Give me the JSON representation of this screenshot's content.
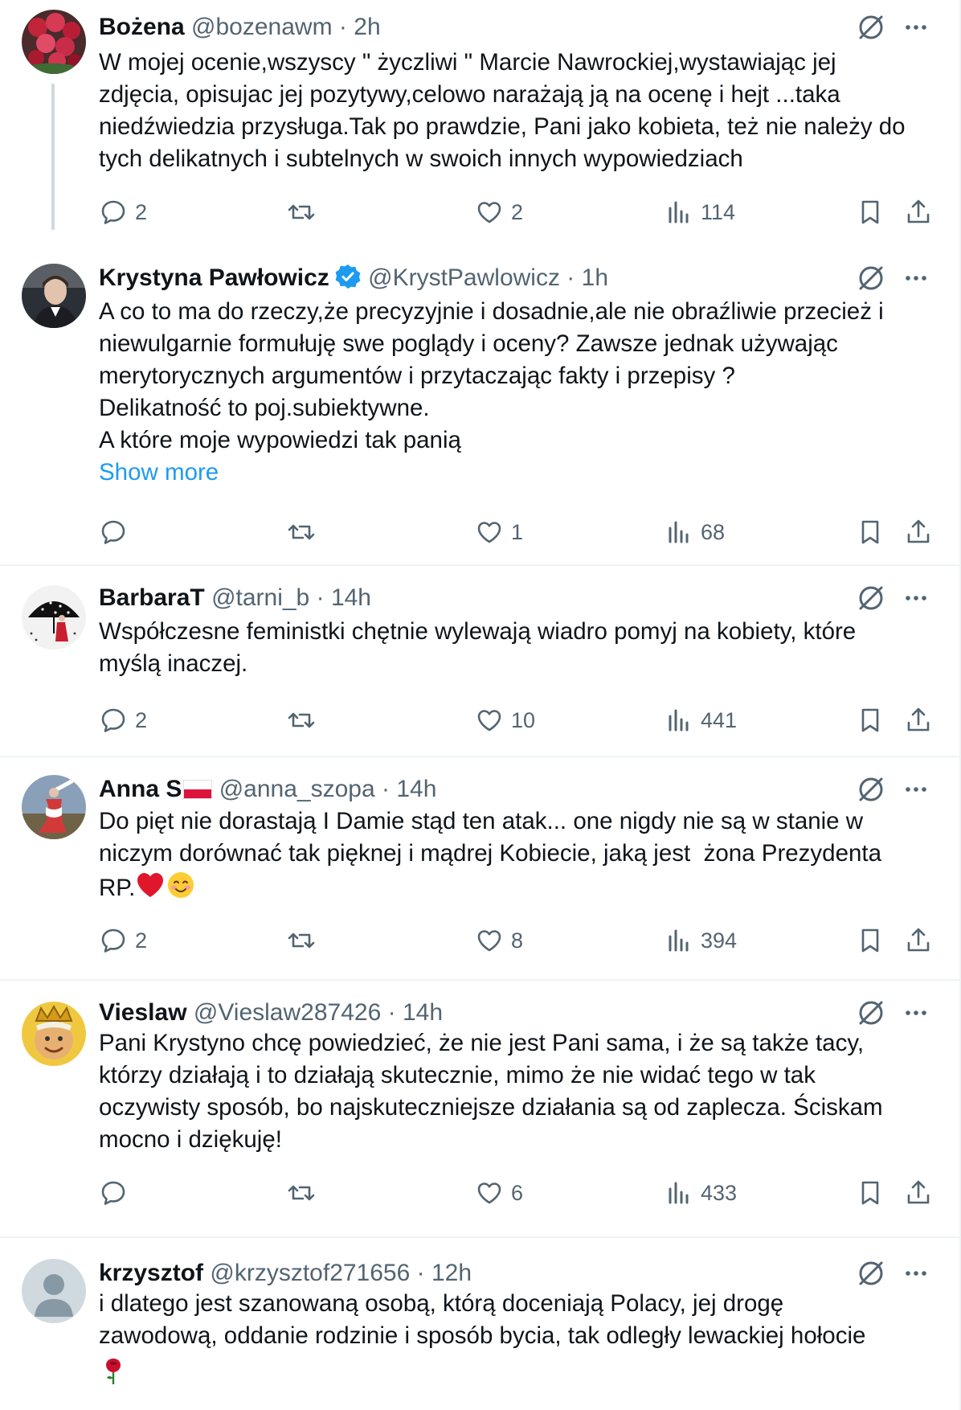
{
  "tweets": [
    {
      "name": "Bożena",
      "handle": "@bozenawm",
      "dot": "·",
      "time": "2h",
      "text": "W mojej ocenie,wszyscy \" życzliwi \" Marcie Nawrockiej,wystawiając jej\nzdjęcia, opisujac jej pozytywy,celowo narażają ją na ocenę i hejt ...taka\nniedźwiedzia przysługa.Tak po prawdzie, Pani jako kobieta, też nie należy do\ntych delikatnych i subtelnych w swoich innych wypowiedziach",
      "replies": "2",
      "reposts": "",
      "likes": "2",
      "views": "114"
    },
    {
      "name": "Krystyna Pawłowicz",
      "handle": "@KrystPawlowicz",
      "dot": "·",
      "time": "1h",
      "verified": true,
      "text": "A co to ma do rzeczy,że precyzyjnie i dosadnie,ale nie obraźliwie przecież i\nniewulgarnie formułuję swe poglądy i oceny? Zawsze jednak używając\nmerytorycznych argumentów i przytaczając fakty i przepisy ?\nDelikatność to poj.subiektywne.\nA które moje wypowiedzi tak panią",
      "show_more": "Show more",
      "replies": "",
      "reposts": "",
      "likes": "1",
      "views": "68"
    },
    {
      "name": "BarbaraT",
      "handle": "@tarni_b",
      "dot": "·",
      "time": "14h",
      "text": "Współczesne feministki chętnie wylewają wiadro pomyj na kobiety, które\nmyślą inaczej.",
      "replies": "2",
      "reposts": "",
      "likes": "10",
      "views": "441"
    },
    {
      "name": "Anna S",
      "handle": "@anna_szopa",
      "dot": "·",
      "time": "14h",
      "flag": "poland-flag",
      "text": "Do pięt nie dorastają I Damie stąd ten atak... one nigdy nie są w stanie w\nniczym dorównać tak pięknej i mądrej Kobiecie, jaką jest  żona Prezydenta\nRP.",
      "replies": "2",
      "reposts": "",
      "likes": "8",
      "views": "394"
    },
    {
      "name": "Vieslaw",
      "handle": "@Vieslaw287426",
      "dot": "·",
      "time": "14h",
      "text": "Pani Krystyno chcę powiedzieć, że nie jest Pani sama, i że są także tacy,\nktórzy działają i to działają skutecznie, mimo że nie widać tego w tak\noczywisty sposób, bo najskuteczniejsze działania są od zaplecza. Ściskam\nmocno i dziękuję!",
      "replies": "",
      "reposts": "",
      "likes": "6",
      "views": "433"
    },
    {
      "name": "krzysztof",
      "handle": "@krzysztof271656",
      "dot": "·",
      "time": "12h",
      "text": "i dlatego jest szanowaną osobą, którą doceniają Polacy, jej drogę\nzawodową, oddanie rodzinie i sposób bycia, tak odległy lewackiej hołocie"
    }
  ],
  "icons": {
    "reply": "reply-icon",
    "repost": "repost-icon",
    "like": "like-icon",
    "views": "views-icon",
    "bookmark": "bookmark-icon",
    "share": "share-icon",
    "grok": "grok-icon",
    "more": "more-icon",
    "verified": "verified-badge-icon",
    "heart_emoji": "red-heart-emoji",
    "smile_emoji": "smiling-face-emoji",
    "rose_emoji": "rose-emoji"
  },
  "colors": {
    "text": "#0f1419",
    "secondary": "#536471",
    "link": "#1d9bf0",
    "divider": "#eff3f4",
    "thread_line": "#cfd9de"
  }
}
